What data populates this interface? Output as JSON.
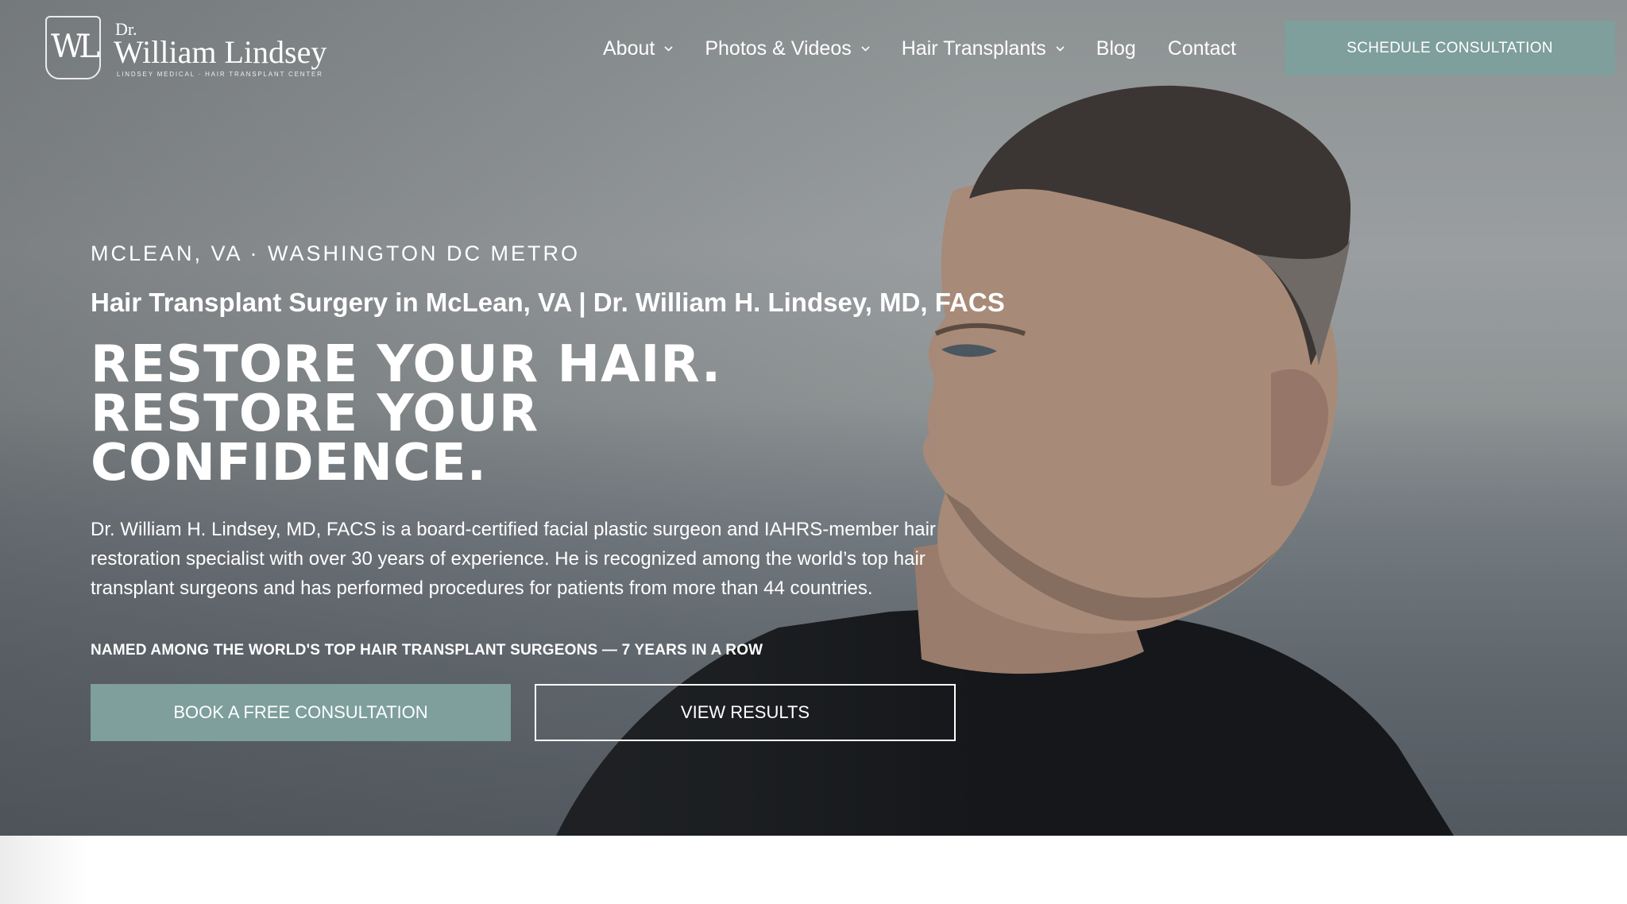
{
  "logo": {
    "monogram": "WL",
    "prefix": "Dr.",
    "name": "William Lindsey",
    "tagline": "LINDSEY MEDICAL · HAIR TRANSPLANT CENTER"
  },
  "nav": {
    "items": [
      {
        "label": "About",
        "icon": "chevron-down-icon"
      },
      {
        "label": "Photos & Videos",
        "icon": "chevron-down-icon"
      },
      {
        "label": "Hair Transplants",
        "icon": "chevron-down-icon"
      },
      {
        "label": "Blog"
      },
      {
        "label": "Contact"
      }
    ],
    "cta": "SCHEDULE CONSULTATION"
  },
  "hero": {
    "eyebrow": "MCLEAN, VA · WASHINGTON DC METRO",
    "subhead": "Hair Transplant Surgery in McLean, VA | Dr. William H. Lindsey, MD, FACS",
    "headline": [
      "RESTORE YOUR HAIR.",
      "RESTORE YOUR",
      "CONFIDENCE."
    ],
    "description": "Dr. William H. Lindsey, MD, FACS is a board-certified facial plastic surgeon and IAHRS-member hair restoration specialist with over 30 years of experience. He is recognized among the world’s top hair transplant surgeons and has performed procedures for patients from more than 44 countries.",
    "award": "NAMED AMONG THE WORLD'S TOP HAIR TRANSPLANT SURGEONS — 7 YEARS IN A ROW",
    "primary_button": "BOOK A FREE CONSULTATION",
    "secondary_button": "VIEW RESULTS"
  },
  "colors": {
    "accent": "#7e9f9c",
    "text": "#ffffff"
  }
}
